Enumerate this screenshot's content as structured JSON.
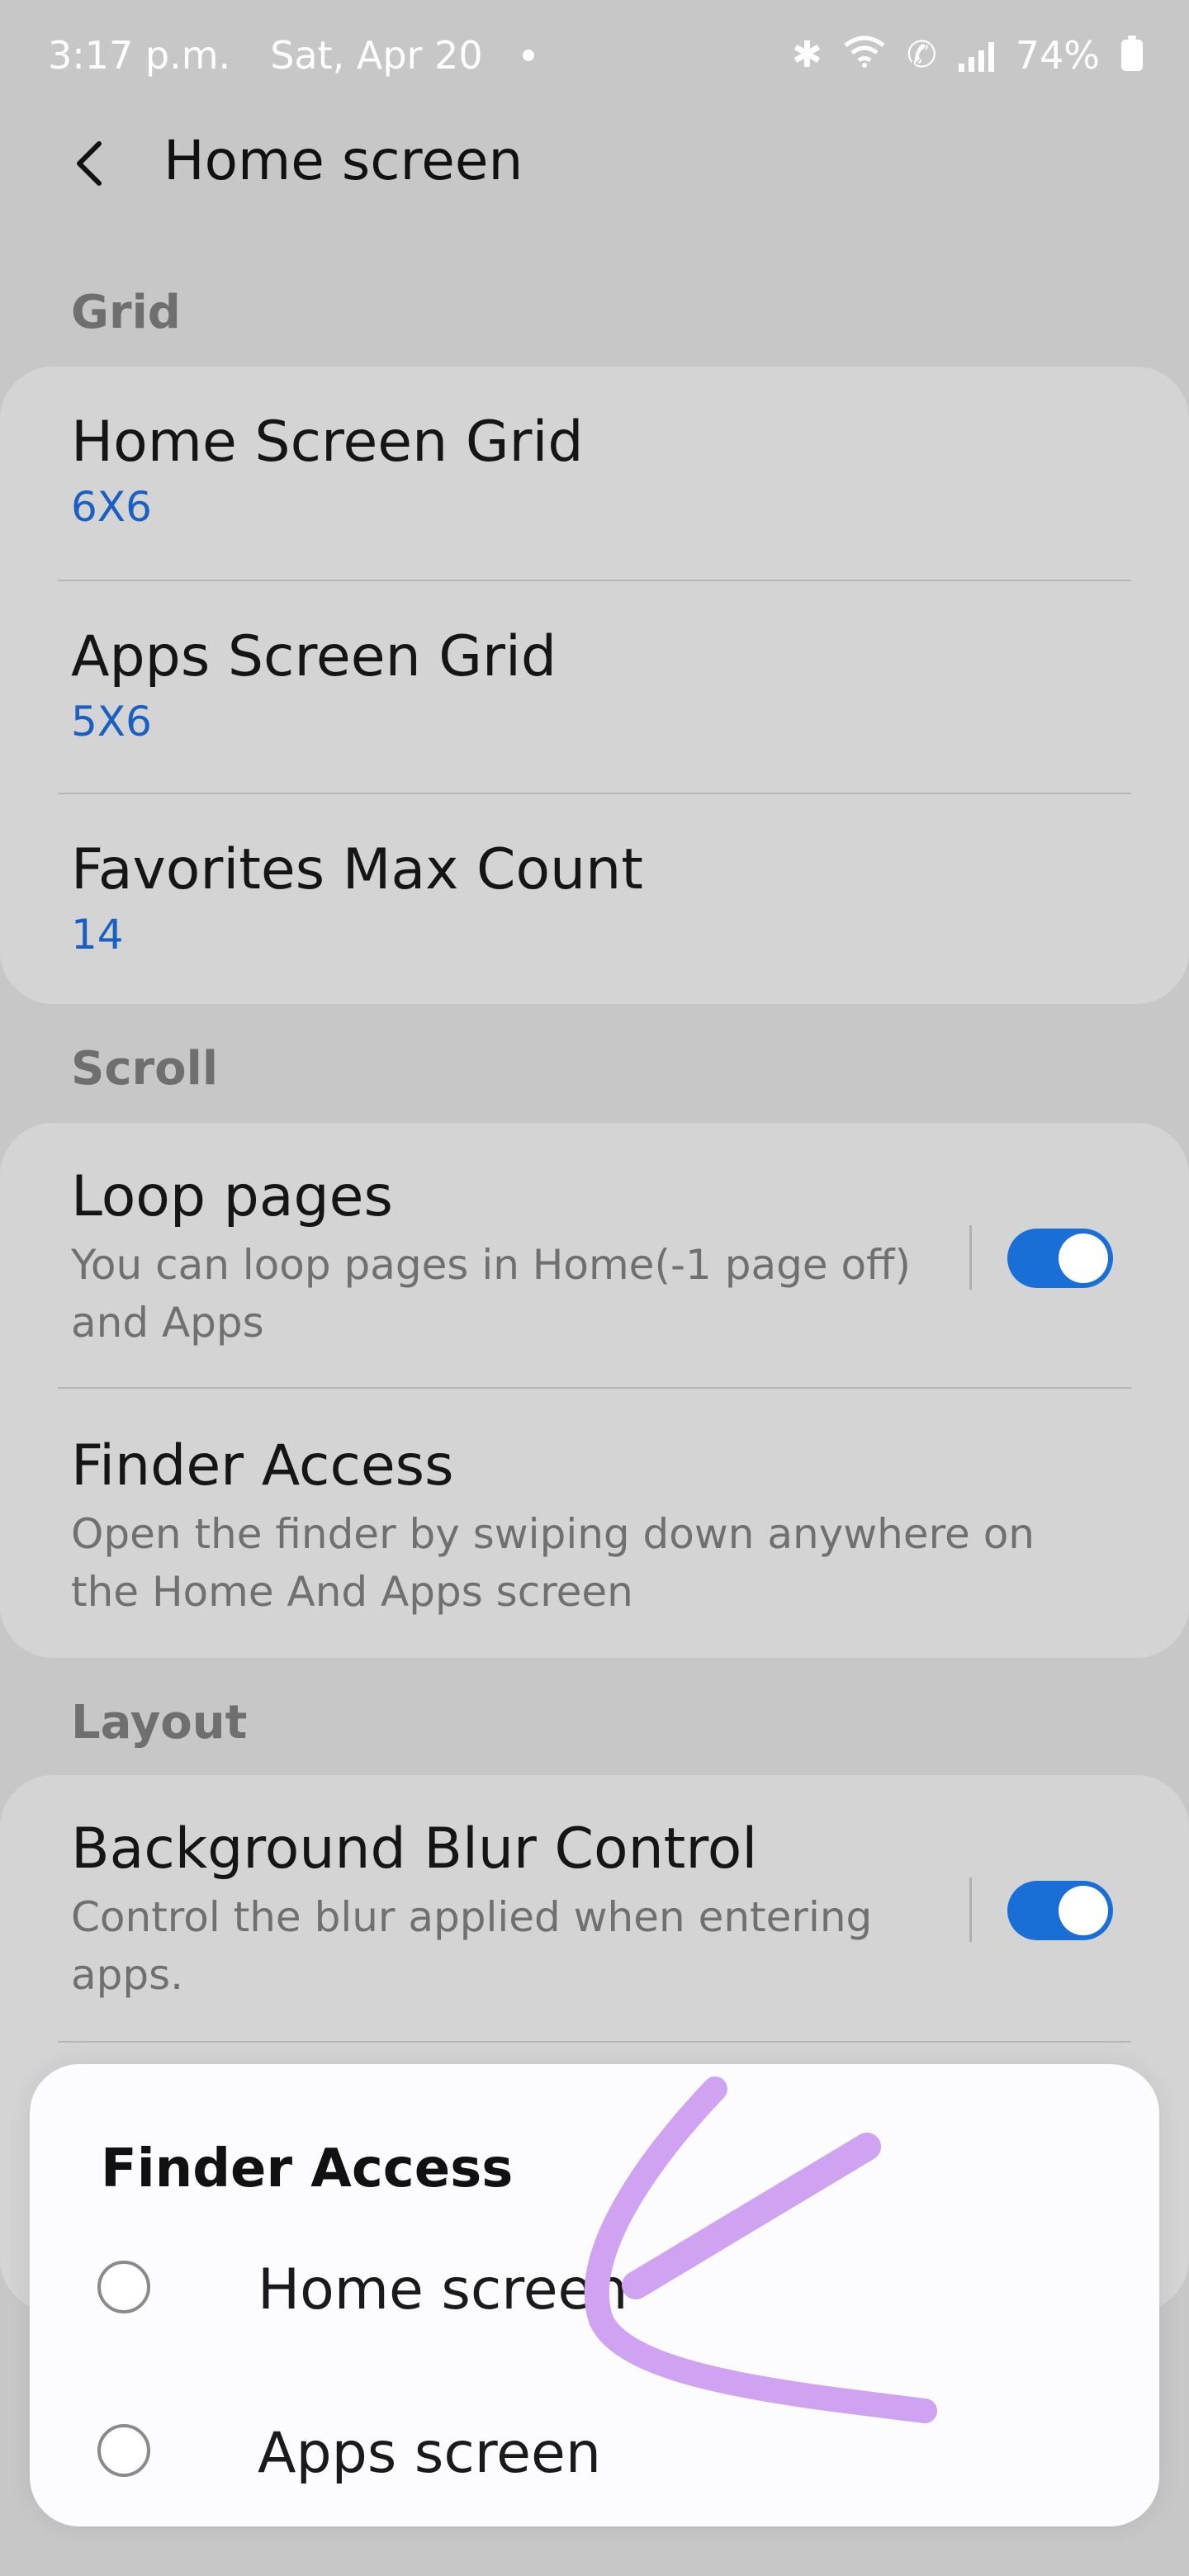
{
  "status": {
    "time": "3:17 p.m.",
    "date": "Sat, Apr 20",
    "battery": "74%"
  },
  "header": {
    "title": "Home screen"
  },
  "sections": {
    "grid": {
      "label": "Grid",
      "items": [
        {
          "title": "Home Screen Grid",
          "value": "6X6"
        },
        {
          "title": "Apps Screen Grid",
          "value": "5X6"
        },
        {
          "title": "Favorites Max Count",
          "value": "14"
        }
      ]
    },
    "scroll": {
      "label": "Scroll",
      "loop": {
        "title": "Loop pages",
        "desc": "You can loop pages in Home(-1 page off) and Apps",
        "enabled": true
      },
      "finder": {
        "title": "Finder Access",
        "desc": "Open the finder by swiping down anywhere on the Home And Apps screen"
      }
    },
    "layout": {
      "label": "Layout",
      "blur": {
        "title": "Background Blur Control",
        "desc": "Control the blur applied when entering apps.",
        "enabled": true
      }
    }
  },
  "dialog": {
    "title": "Finder Access",
    "options": [
      {
        "label": "Home screen",
        "selected": false
      },
      {
        "label": "Apps screen",
        "selected": false
      }
    ]
  },
  "colors": {
    "accent": "#1a6fd7",
    "value_blue": "#1a5fc2",
    "annotation": "#cfa2f2",
    "background": "#c7c7c7"
  },
  "icons": [
    "back-arrow-icon",
    "bluetooth-icon",
    "wifi-icon",
    "wifi-calling-icon",
    "signal-icon",
    "battery-icon"
  ]
}
